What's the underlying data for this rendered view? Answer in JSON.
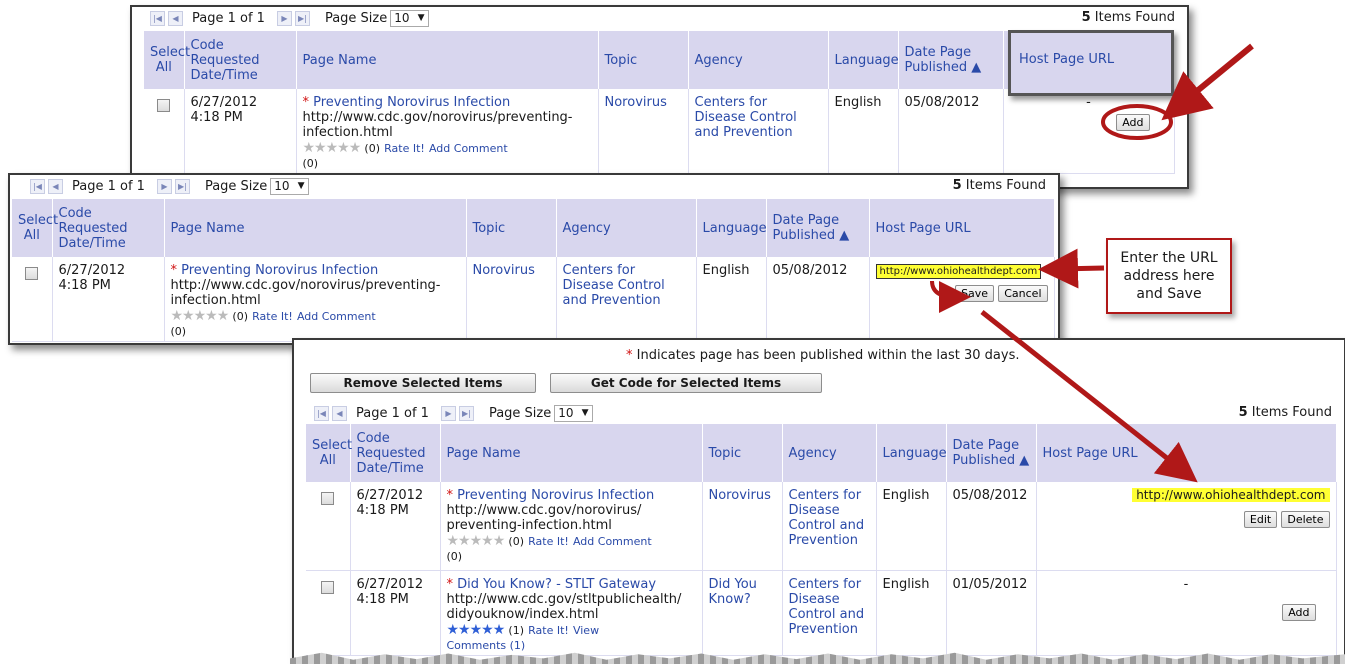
{
  "shared": {
    "page_text": "Page 1 of 1",
    "page_size_label": "Page Size",
    "page_size_value": "10",
    "items_found_count": "5",
    "items_found_label": "Items Found"
  },
  "columns": {
    "select_all": "Select All",
    "code_requested": "Code Requested Date/Time",
    "page_name": "Page Name",
    "topic": "Topic",
    "agency": "Agency",
    "language": "Language",
    "date_published": "Date Page Published",
    "sort_arrow": "^",
    "host_url": "Host Page URL"
  },
  "row_norovirus": {
    "date": "6/27/2012",
    "time": "4:18 PM",
    "asterisk": "*",
    "title": "Preventing Norovirus Infection",
    "url_one_line": "http://www.cdc.gov/norovirus/preventing-",
    "url_rest": "infection.html",
    "url_part1": "http://www.cdc.gov/norovirus/",
    "url_part2": "preventing-infection.html",
    "rating_count": "(0)",
    "rate_it": "Rate It!",
    "add_comment": "Add Comment",
    "comments_count": "(0)",
    "topic": "Norovirus",
    "agency": "Centers for Disease Control and Prevention",
    "language": "English",
    "published": "05/08/2012"
  },
  "row_dyk": {
    "date": "6/27/2012",
    "time": "4:18 PM",
    "asterisk": "*",
    "title": "Did You Know? - STLT Gateway",
    "url_part1": "http://www.cdc.gov/stltpublichealth/",
    "url_part2": "didyouknow/index.html",
    "rating_count": "(1)",
    "rate_it": "Rate It!",
    "view": "View",
    "comments": "Comments (1)",
    "topic": "Did You Know?",
    "agency": "Centers for Disease Control and Prevention",
    "language": "English",
    "published": "01/05/2012",
    "host_dash": "-"
  },
  "panel1": {
    "host_dash": "-",
    "add_button": "Add"
  },
  "panel2": {
    "url_input": "http://www.ohiohealthdept.com",
    "save_button": "Save",
    "cancel_button": "Cancel"
  },
  "panel3": {
    "notice_asterisk": "*",
    "notice_text": "Indicates page has been published within the last 30 days.",
    "remove_button": "Remove Selected Items",
    "get_code_button": "Get Code for Selected Items",
    "host_url_value": "http://www.ohiohealthdept.com",
    "edit_button": "Edit",
    "delete_button": "Delete",
    "add_button": "Add"
  },
  "callout": {
    "line1": "Enter the URL",
    "line2": "address here",
    "line3": "and Save"
  },
  "icons": {
    "first": "first-page-icon",
    "prev": "prev-page-icon",
    "next": "next-page-icon",
    "last": "last-page-icon",
    "star": "star-icon"
  },
  "colors": {
    "header_bg": "#d8d6ee",
    "link_blue": "#2a4aa8",
    "highlight": "#ffff33",
    "arrow_red": "#b01818"
  }
}
